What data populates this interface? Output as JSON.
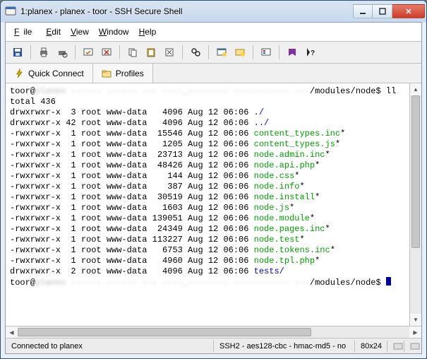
{
  "window": {
    "title": "1:planex - planex - toor - SSH Secure Shell"
  },
  "menu": {
    "file": "File",
    "edit": "Edit",
    "view": "View",
    "window": "Window",
    "help": "Help"
  },
  "quick": {
    "connect": "Quick Connect",
    "profiles": "Profiles"
  },
  "prompt": {
    "user": "toor@",
    "host_blurred": "planex ------ ------ --- ----_-------- ----------- ---",
    "path": "/modules/node$",
    "cmd": "ll"
  },
  "total_line": "total 436",
  "listing": [
    {
      "perm": "drwxrwxr-x",
      "links": "3",
      "owner": "root",
      "group": "www-data",
      "size": "4096",
      "date": "Aug 12 06:06",
      "name": "./",
      "cls": "blue"
    },
    {
      "perm": "drwxrwxr-x",
      "links": "42",
      "owner": "root",
      "group": "www-data",
      "size": "4096",
      "date": "Aug 12 06:06",
      "name": "../",
      "cls": "blue"
    },
    {
      "perm": "-rwxrwxr-x",
      "links": "1",
      "owner": "root",
      "group": "www-data",
      "size": "15546",
      "date": "Aug 12 06:06",
      "name": "content_types.inc",
      "suffix": "*",
      "cls": "green"
    },
    {
      "perm": "-rwxrwxr-x",
      "links": "1",
      "owner": "root",
      "group": "www-data",
      "size": "1205",
      "date": "Aug 12 06:06",
      "name": "content_types.js",
      "suffix": "*",
      "cls": "green"
    },
    {
      "perm": "-rwxrwxr-x",
      "links": "1",
      "owner": "root",
      "group": "www-data",
      "size": "23713",
      "date": "Aug 12 06:06",
      "name": "node.admin.inc",
      "suffix": "*",
      "cls": "green"
    },
    {
      "perm": "-rwxrwxr-x",
      "links": "1",
      "owner": "root",
      "group": "www-data",
      "size": "48426",
      "date": "Aug 12 06:06",
      "name": "node.api.php",
      "suffix": "*",
      "cls": "green"
    },
    {
      "perm": "-rwxrwxr-x",
      "links": "1",
      "owner": "root",
      "group": "www-data",
      "size": "144",
      "date": "Aug 12 06:06",
      "name": "node.css",
      "suffix": "*",
      "cls": "green"
    },
    {
      "perm": "-rwxrwxr-x",
      "links": "1",
      "owner": "root",
      "group": "www-data",
      "size": "387",
      "date": "Aug 12 06:06",
      "name": "node.info",
      "suffix": "*",
      "cls": "green"
    },
    {
      "perm": "-rwxrwxr-x",
      "links": "1",
      "owner": "root",
      "group": "www-data",
      "size": "30519",
      "date": "Aug 12 06:06",
      "name": "node.install",
      "suffix": "*",
      "cls": "green"
    },
    {
      "perm": "-rwxrwxr-x",
      "links": "1",
      "owner": "root",
      "group": "www-data",
      "size": "1603",
      "date": "Aug 12 06:06",
      "name": "node.js",
      "suffix": "*",
      "cls": "green"
    },
    {
      "perm": "-rwxrwxr-x",
      "links": "1",
      "owner": "root",
      "group": "www-data",
      "size": "139051",
      "date": "Aug 12 06:06",
      "name": "node.module",
      "suffix": "*",
      "cls": "green"
    },
    {
      "perm": "-rwxrwxr-x",
      "links": "1",
      "owner": "root",
      "group": "www-data",
      "size": "24349",
      "date": "Aug 12 06:06",
      "name": "node.pages.inc",
      "suffix": "*",
      "cls": "green"
    },
    {
      "perm": "-rwxrwxr-x",
      "links": "1",
      "owner": "root",
      "group": "www-data",
      "size": "113227",
      "date": "Aug 12 06:06",
      "name": "node.test",
      "suffix": "*",
      "cls": "green"
    },
    {
      "perm": "-rwxrwxr-x",
      "links": "1",
      "owner": "root",
      "group": "www-data",
      "size": "6753",
      "date": "Aug 12 06:06",
      "name": "node.tokens.inc",
      "suffix": "*",
      "cls": "green"
    },
    {
      "perm": "-rwxrwxr-x",
      "links": "1",
      "owner": "root",
      "group": "www-data",
      "size": "4960",
      "date": "Aug 12 06:06",
      "name": "node.tpl.php",
      "suffix": "*",
      "cls": "green"
    },
    {
      "perm": "drwxrwxr-x",
      "links": "2",
      "owner": "root",
      "group": "www-data",
      "size": "4096",
      "date": "Aug 12 06:06",
      "name": "tests/",
      "cls": "blue"
    }
  ],
  "status": {
    "connection": "Connected to planex",
    "cipher": "SSH2 - aes128-cbc - hmac-md5 - no",
    "size": "80x24"
  }
}
